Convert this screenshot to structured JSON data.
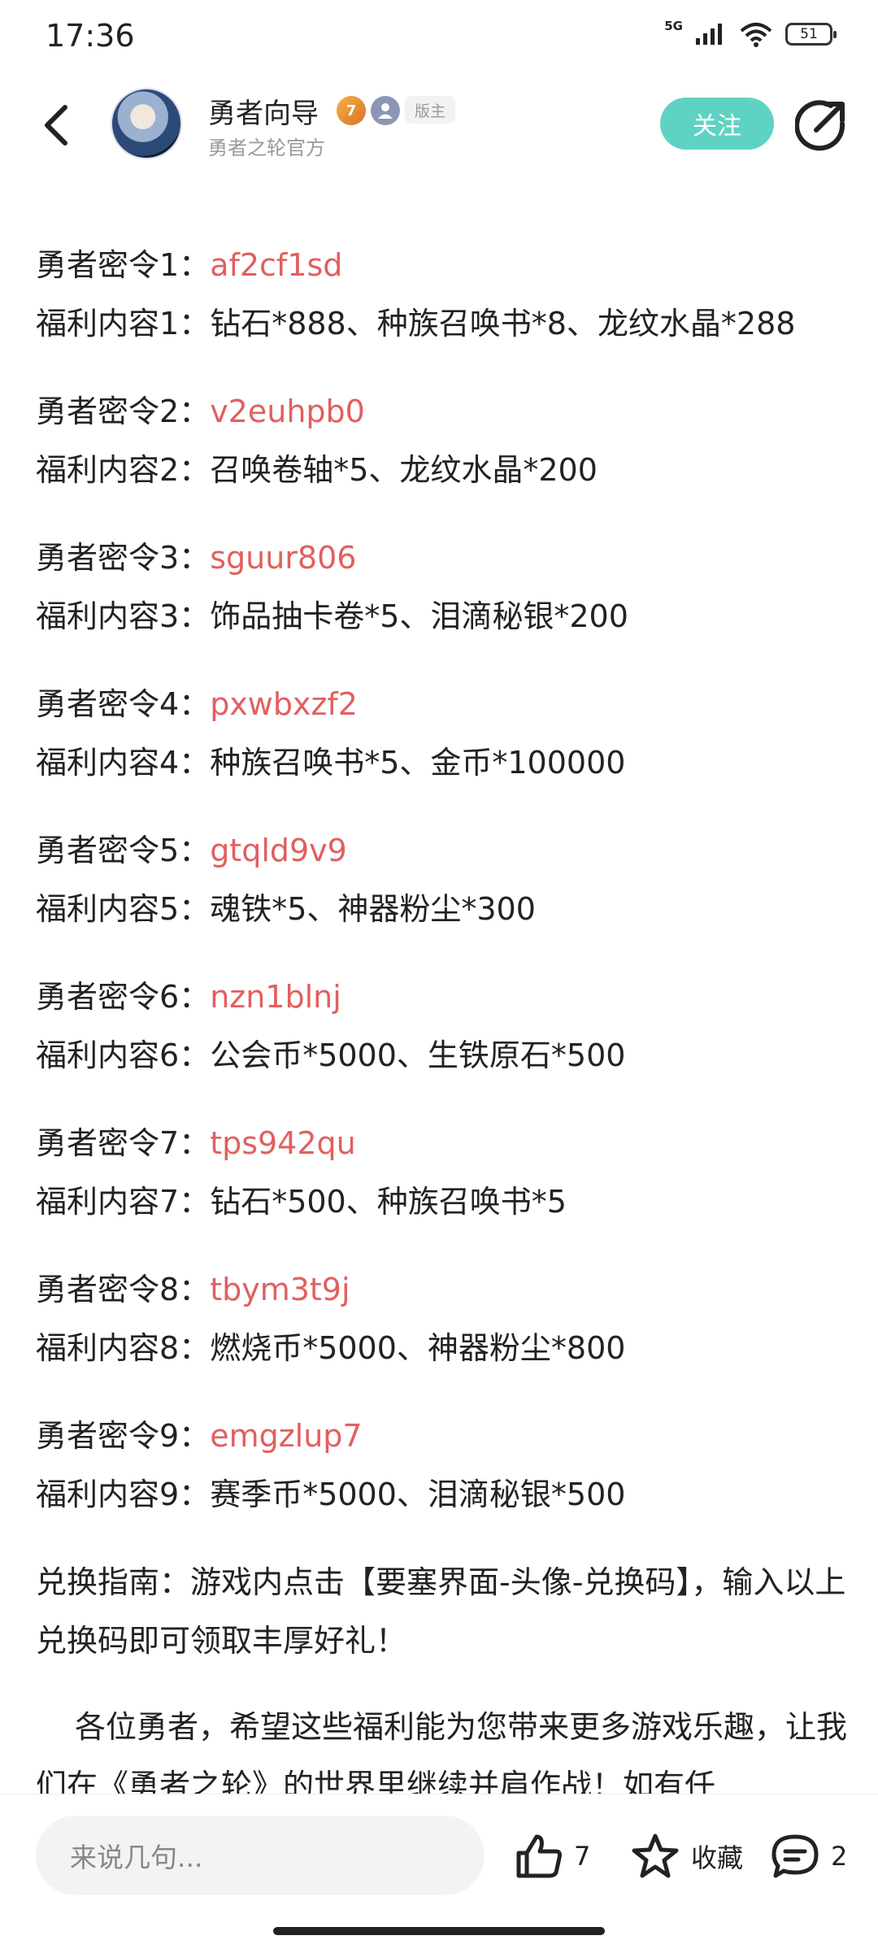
{
  "status_bar": {
    "time": "17:36",
    "network": "5G",
    "battery": "51"
  },
  "header": {
    "author_name": "勇者向导",
    "medal_level": "7",
    "mod_badge": "版主",
    "author_subtitle": "勇者之轮官方",
    "follow_label": "关注"
  },
  "content": {
    "codes": [
      {
        "code_label": "勇者密令1：",
        "code": "af2cf1sd",
        "reward_label": "福利内容1：",
        "reward": "钻石*888、种族召唤书*8、龙纹水晶*288"
      },
      {
        "code_label": "勇者密令2：",
        "code": "v2euhpb0",
        "reward_label": "福利内容2：",
        "reward": "召唤卷轴*5、龙纹水晶*200"
      },
      {
        "code_label": "勇者密令3：",
        "code": "sguur806",
        "reward_label": "福利内容3：",
        "reward": "饰品抽卡卷*5、泪滴秘银*200"
      },
      {
        "code_label": "勇者密令4：",
        "code": "pxwbxzf2",
        "reward_label": "福利内容4：",
        "reward": "种族召唤书*5、金币*100000"
      },
      {
        "code_label": "勇者密令5：",
        "code": "gtqld9v9",
        "reward_label": "福利内容5：",
        "reward": "魂铁*5、神器粉尘*300"
      },
      {
        "code_label": "勇者密令6：",
        "code": "nzn1blnj",
        "reward_label": "福利内容6：",
        "reward": "公会币*5000、生铁原石*500"
      },
      {
        "code_label": "勇者密令7：",
        "code": "tps942qu",
        "reward_label": "福利内容7：",
        "reward": "钻石*500、种族召唤书*5"
      },
      {
        "code_label": "勇者密令8：",
        "code": "tbym3t9j",
        "reward_label": "福利内容8：",
        "reward": "燃烧币*5000、神器粉尘*800"
      },
      {
        "code_label": "勇者密令9：",
        "code": "emgzlup7",
        "reward_label": "福利内容9：",
        "reward": "赛季币*5000、泪滴秘银*500"
      }
    ],
    "guide": "兑换指南：游戏内点击【要塞界面-头像-兑换码】，输入以上兑换码即可领取丰厚好礼！",
    "paragraph": "各位勇者，希望这些福利能为您带来更多游戏乐趣，让我们在《勇者之轮》的世界里继续并肩作战！如有任"
  },
  "bottom_bar": {
    "comment_placeholder": "来说几句...",
    "like_count": "7",
    "favorite_label": "收藏",
    "comment_count": "2"
  },
  "colors": {
    "accent": "#5fd3c3",
    "code_red": "#e0605f"
  }
}
